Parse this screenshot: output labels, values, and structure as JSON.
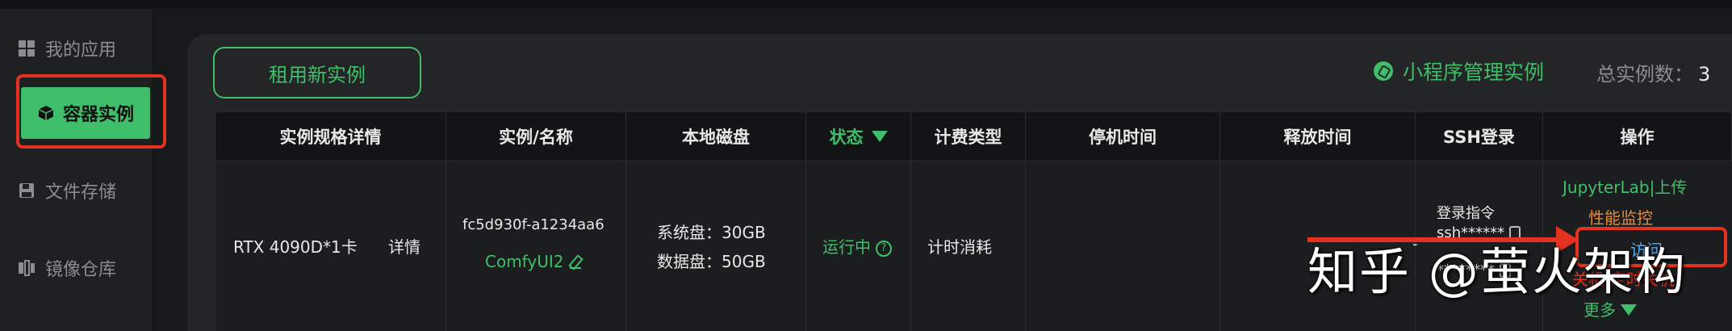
{
  "sidebar": {
    "items": [
      {
        "label": "我的应用",
        "icon": "apps-icon",
        "active": false
      },
      {
        "label": "容器实例",
        "icon": "cube-icon",
        "active": true
      },
      {
        "label": "文件存储",
        "icon": "save-icon",
        "active": false
      },
      {
        "label": "镜像仓库",
        "icon": "image-repo-icon",
        "active": false
      }
    ]
  },
  "toolbar": {
    "rent_label": "租用新实例",
    "mini_program_label": "小程序管理实例",
    "total_label": "总实例数：",
    "total_count": "3"
  },
  "table": {
    "headers": [
      "实例规格详情",
      "实例/名称",
      "本地磁盘",
      "状态",
      "计费类型",
      "停机时间",
      "释放时间",
      "SSH登录",
      "操作"
    ],
    "row": {
      "spec": "RTX 4090D*1卡",
      "detail_link": "详情",
      "instance_id": "fc5d930f-a1234aa6",
      "instance_name": "ComfyUI2",
      "system_disk": "系统盘：30GB",
      "data_disk": "数据盘：50GB",
      "status": "运行中",
      "billing": "计时消耗",
      "stop_time": "",
      "release_time": "",
      "ssh_title": "登录指令",
      "ssh_cmd": "ssh******",
      "ssh_dash": "-",
      "ssh_pwd": "********",
      "ops": {
        "jupyter_upload": "JupyterLab|上传",
        "monitor": "性能监控",
        "access": "访问",
        "shutdown": "关机|定时关机",
        "more": "更多"
      }
    }
  },
  "watermark": "知乎 @萤火架构",
  "colors": {
    "accent": "#3fbf6a",
    "highlight": "#e3321f",
    "warning": "#e88a3a",
    "background": "#17181a"
  }
}
